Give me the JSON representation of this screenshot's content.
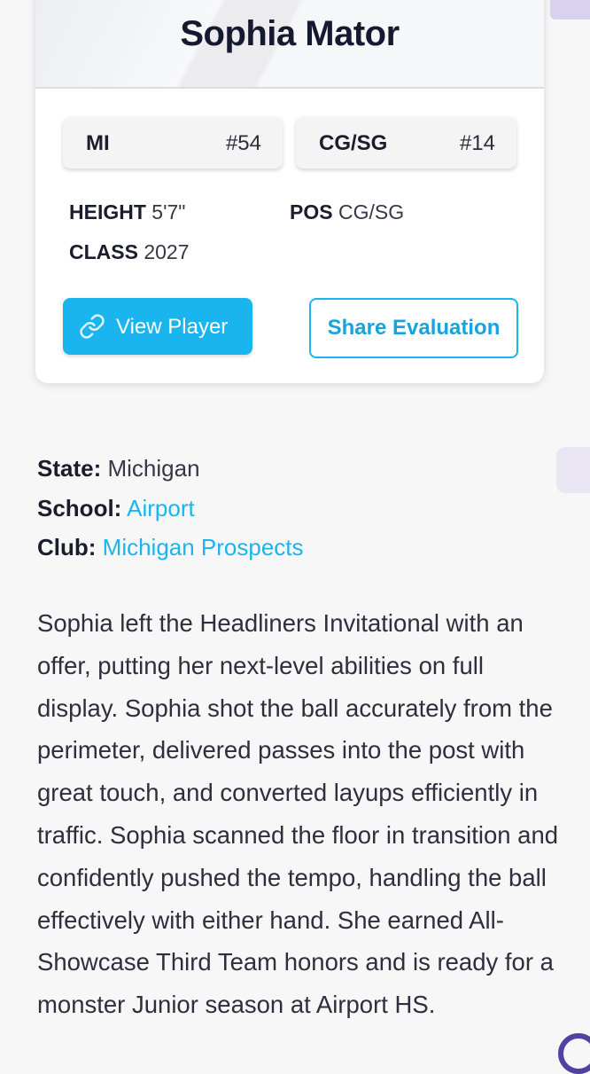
{
  "player": {
    "name": "Sophia Mator",
    "state_abbr": "MI",
    "state_number": "#54",
    "position_chip": "CG/SG",
    "position_number": "#14",
    "height_label": "HEIGHT",
    "height_value": "5'7\"",
    "class_label": "CLASS",
    "class_value": "2027",
    "pos_label": "POS",
    "pos_value": "CG/SG"
  },
  "buttons": {
    "view_player": "View Player",
    "view_player_icon": "link-icon",
    "share_evaluation": "Share Evaluation"
  },
  "details": {
    "state_label": "State:",
    "state_value": "Michigan",
    "school_label": "School:",
    "school_value": "Airport",
    "club_label": "Club:",
    "club_value": "Michigan Prospects"
  },
  "bio": "Sophia left the Headliners Invitational with an offer, putting her next-level abilities on full display. Sophia shot the ball accurately from the perimeter, delivered passes into the post with great touch, and converted layups efficiently in traffic. Sophia scanned the floor in transition and confidently pushed the tempo, handling the ball effectively with either hand. She earned All-Showcase Third Team honors and is ready for a monster Junior season at Airport HS.",
  "colors": {
    "accent": "#1ab5ee",
    "title": "#161a30",
    "text": "#2d303c"
  }
}
